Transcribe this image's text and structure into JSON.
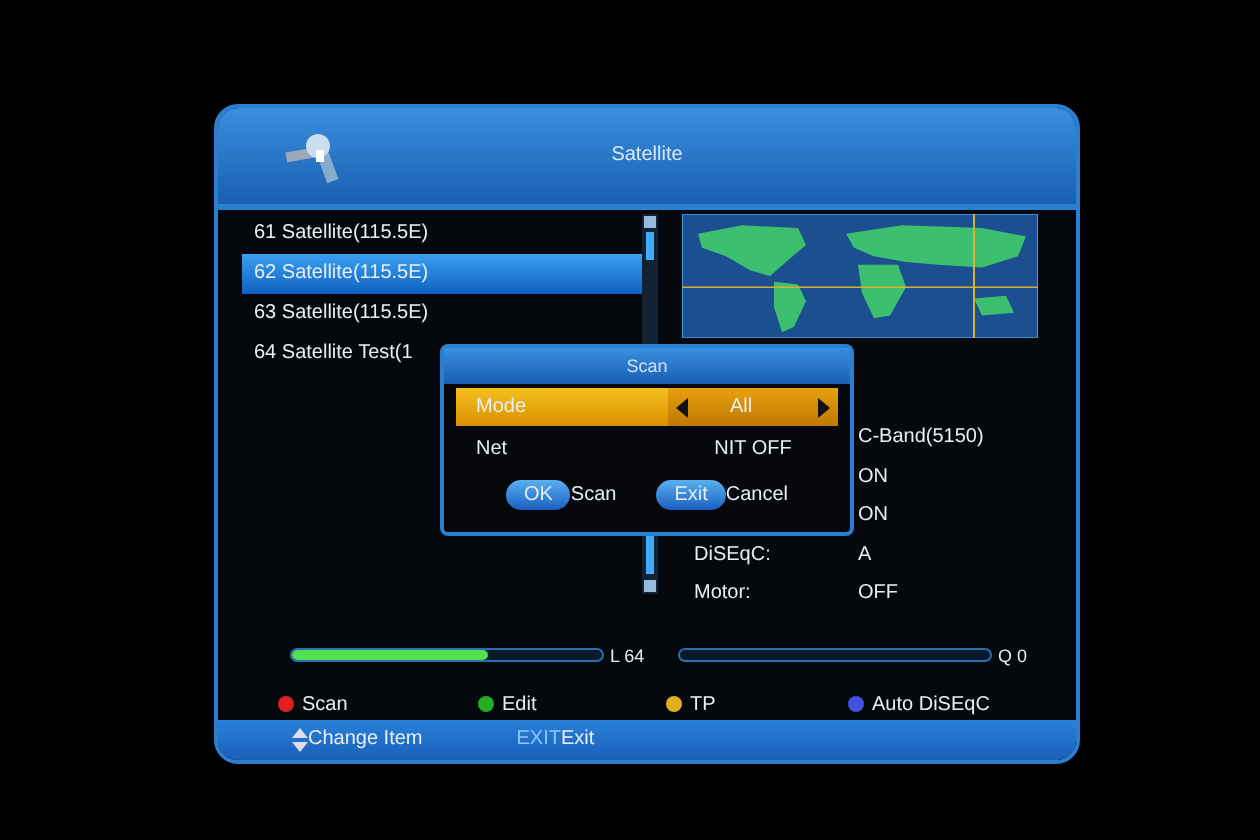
{
  "window": {
    "title": "Satellite"
  },
  "satellites": [
    {
      "label": "61  Satellite(115.5E)",
      "selected": false
    },
    {
      "label": "62  Satellite(115.5E)",
      "selected": true
    },
    {
      "label": "63  Satellite(115.5E)",
      "selected": false
    },
    {
      "label": "64  Satellite Test(1",
      "selected": false
    }
  ],
  "info": [
    {
      "value": "C-Band(5150)"
    },
    {
      "value": "ON"
    },
    {
      "value": "ON"
    },
    {
      "label": "DiSEqC:",
      "value": "A"
    },
    {
      "label": "Motor:",
      "value": "OFF"
    }
  ],
  "signal": [
    {
      "label": "L  64",
      "level": 0.63
    },
    {
      "label": "Q 0",
      "level": 0
    }
  ],
  "color_keys": [
    {
      "label": "Scan",
      "color": "#e02020"
    },
    {
      "label": "Edit",
      "color": "#20b020"
    },
    {
      "label": "TP",
      "color": "#e0b020"
    },
    {
      "label": "Auto DiSEqC",
      "color": "#4050e0"
    }
  ],
  "footer": [
    {
      "kind": "updown",
      "label": "Change Item"
    },
    {
      "kind": "key",
      "key": "EXIT",
      "label": "Exit"
    }
  ],
  "dialog": {
    "title": "Scan",
    "rows": [
      {
        "label": "Mode",
        "value": "All",
        "selected": true
      },
      {
        "label": "Net",
        "value": "NIT OFF",
        "selected": false
      }
    ],
    "buttons": [
      {
        "key": "OK",
        "label": "Scan"
      },
      {
        "key": "Exit",
        "label": "Cancel"
      }
    ]
  }
}
